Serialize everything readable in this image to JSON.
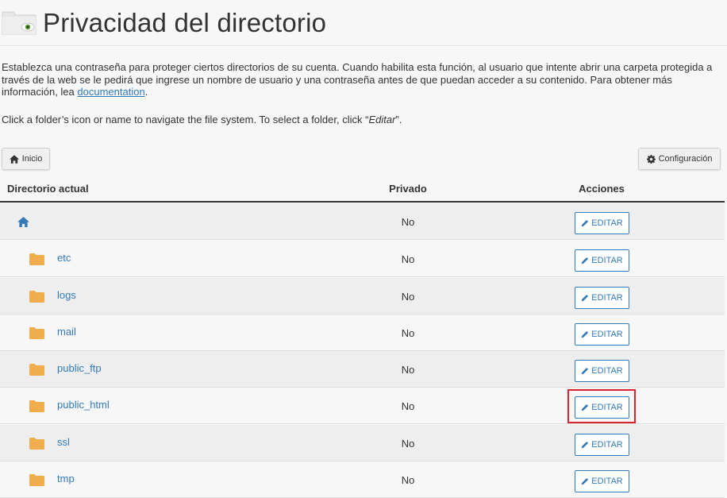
{
  "header": {
    "title": "Privacidad del directorio",
    "icon": "folder-eye-icon"
  },
  "description": {
    "text_before_link": "Establezca una contraseña para proteger ciertos directorios de su cuenta. Cuando habilita esta función, al usuario que intente abrir una carpeta protegida a través de la web se le pedirá que ingrese un nombre de usuario y una contraseña antes de que puedan acceder a su contenido. Para obtener más información, lea ",
    "link_text": "documentation",
    "text_after_link": "."
  },
  "instruction": {
    "before": "Click a folder’s icon or name to navigate the file system. To select a folder, click “",
    "emphasis": "Editar",
    "after": "”."
  },
  "toolbar": {
    "home_label": "Inicio",
    "home_icon": "home-icon",
    "settings_label": "Configuración",
    "settings_icon": "gear-icon"
  },
  "table": {
    "columns": [
      "Directorio actual",
      "Privado",
      "Acciones"
    ],
    "rows": [
      {
        "name": "",
        "icon": "home-icon",
        "private": "No",
        "action": "EDITAR"
      },
      {
        "name": "etc",
        "icon": "folder-icon",
        "private": "No",
        "action": "EDITAR"
      },
      {
        "name": "logs",
        "icon": "folder-icon",
        "private": "No",
        "action": "EDITAR"
      },
      {
        "name": "mail",
        "icon": "folder-icon",
        "private": "No",
        "action": "EDITAR"
      },
      {
        "name": "public_ftp",
        "icon": "folder-icon",
        "private": "No",
        "action": "EDITAR"
      },
      {
        "name": "public_html",
        "icon": "folder-icon",
        "private": "No",
        "action": "EDITAR",
        "highlighted": true
      },
      {
        "name": "ssl",
        "icon": "folder-icon",
        "private": "No",
        "action": "EDITAR"
      },
      {
        "name": "tmp",
        "icon": "folder-icon",
        "private": "No",
        "action": "EDITAR"
      }
    ]
  },
  "colors": {
    "link": "#337ab7",
    "folder": "#f0ad4e",
    "highlight": "#d9232e",
    "background": "#f7f7f7",
    "row_alt": "#eeeeee"
  }
}
